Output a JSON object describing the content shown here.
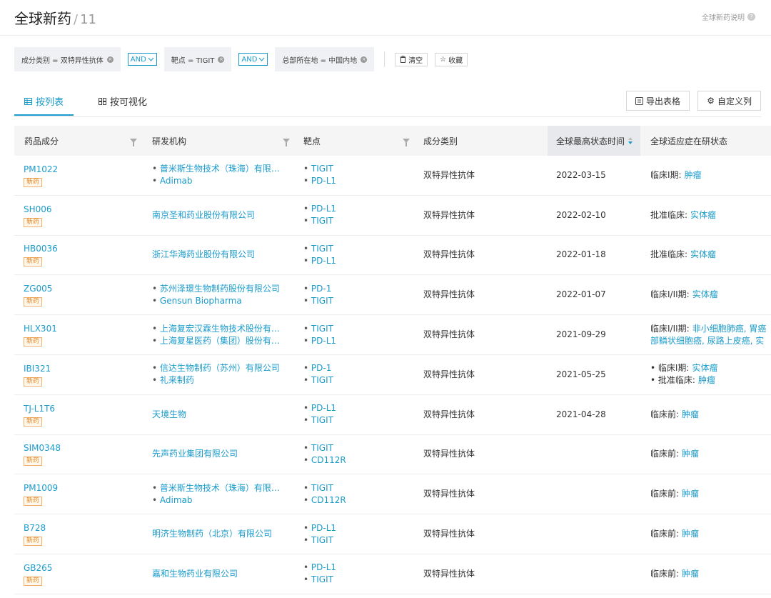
{
  "header": {
    "title": "全球新药",
    "separator": "/",
    "count": "11",
    "help_label": "全球新药说明"
  },
  "filters": {
    "chips": [
      {
        "label": "成分类别 = 双特异性抗体"
      },
      {
        "label": "靶点 = TIGIT"
      },
      {
        "label": "总部所在地 = 中国内地"
      }
    ],
    "and_label": "AND",
    "clear_label": "清空",
    "favorite_label": "收藏"
  },
  "tabs": {
    "list_label": "按列表",
    "visual_label": "按可视化",
    "export_label": "导出表格",
    "custom_label": "自定义列"
  },
  "columns": {
    "drug": "药品成分",
    "org": "研发机构",
    "target": "靶点",
    "category": "成分类别",
    "time": "全球最高状态时间",
    "status": "全球适应症在研状态"
  },
  "badge_label": "新药",
  "rows": [
    {
      "name": "PM1022",
      "orgs": [
        "普米斯生物技术（珠海）有限公司",
        "Adimab"
      ],
      "targets": [
        "TIGIT",
        "PD-L1"
      ],
      "category": "双特异性抗体",
      "date": "2022-03-15",
      "status": [
        {
          "stage": "临床I期:",
          "ind": "肿瘤"
        }
      ]
    },
    {
      "name": "SH006",
      "orgs": [
        "南京圣和药业股份有限公司"
      ],
      "targets": [
        "PD-L1",
        "TIGIT"
      ],
      "category": "双特异性抗体",
      "date": "2022-02-10",
      "status": [
        {
          "stage": "批准临床:",
          "ind": "实体瘤"
        }
      ]
    },
    {
      "name": "HB0036",
      "orgs": [
        "浙江华海药业股份有限公司"
      ],
      "targets": [
        "TIGIT",
        "PD-L1"
      ],
      "category": "双特异性抗体",
      "date": "2022-01-18",
      "status": [
        {
          "stage": "批准临床:",
          "ind": "实体瘤"
        }
      ]
    },
    {
      "name": "ZG005",
      "orgs": [
        "苏州泽璟生物制药股份有限公司",
        "Gensun Biopharma"
      ],
      "targets": [
        "PD-1",
        "TIGIT"
      ],
      "category": "双特异性抗体",
      "date": "2022-01-07",
      "status": [
        {
          "stage": "临床I/II期:",
          "ind": "实体瘤"
        }
      ]
    },
    {
      "name": "HLX301",
      "orgs": [
        "上海复宏汉霖生物技术股份有限...",
        "上海复星医药（集团）股份有限..."
      ],
      "targets": [
        "TIGIT",
        "PD-L1"
      ],
      "category": "双特异性抗体",
      "date": "2021-09-29",
      "status": [
        {
          "stage": "临床I/II期:",
          "ind": "非小细胞肺癌, 胃癌"
        },
        {
          "stage": "",
          "ind": "部鳞状细胞癌, 尿路上皮癌, 实"
        }
      ]
    },
    {
      "name": "IBI321",
      "orgs": [
        "信达生物制药（苏州）有限公司",
        "礼来制药"
      ],
      "targets": [
        "PD-1",
        "TIGIT"
      ],
      "category": "双特异性抗体",
      "date": "2021-05-25",
      "status": [
        {
          "stage": "• 临床I期:",
          "ind": "实体瘤"
        },
        {
          "stage": "• 批准临床:",
          "ind": "肿瘤"
        }
      ]
    },
    {
      "name": "TJ-L1T6",
      "orgs": [
        "天境生物"
      ],
      "targets": [
        "PD-L1",
        "TIGIT"
      ],
      "category": "双特异性抗体",
      "date": "2021-04-28",
      "status": [
        {
          "stage": "临床前:",
          "ind": "肿瘤"
        }
      ]
    },
    {
      "name": "SIM0348",
      "orgs": [
        "先声药业集团有限公司"
      ],
      "targets": [
        "TIGIT",
        "CD112R"
      ],
      "category": "双特异性抗体",
      "date": "",
      "status": [
        {
          "stage": "临床前:",
          "ind": "肿瘤"
        }
      ]
    },
    {
      "name": "PM1009",
      "orgs": [
        "普米斯生物技术（珠海）有限公司",
        "Adimab"
      ],
      "targets": [
        "TIGIT",
        "CD112R"
      ],
      "category": "双特异性抗体",
      "date": "",
      "status": [
        {
          "stage": "临床前:",
          "ind": "肿瘤"
        }
      ]
    },
    {
      "name": "B728",
      "orgs": [
        "明济生物制药（北京）有限公司"
      ],
      "targets": [
        "PD-L1",
        "TIGIT"
      ],
      "category": "双特异性抗体",
      "date": "",
      "status": [
        {
          "stage": "临床前:",
          "ind": "肿瘤"
        }
      ]
    },
    {
      "name": "GB265",
      "orgs": [
        "嘉和生物药业有限公司"
      ],
      "targets": [
        "PD-L1",
        "TIGIT"
      ],
      "category": "双特异性抗体",
      "date": "",
      "status": [
        {
          "stage": "临床前:",
          "ind": "肿瘤"
        }
      ]
    }
  ]
}
